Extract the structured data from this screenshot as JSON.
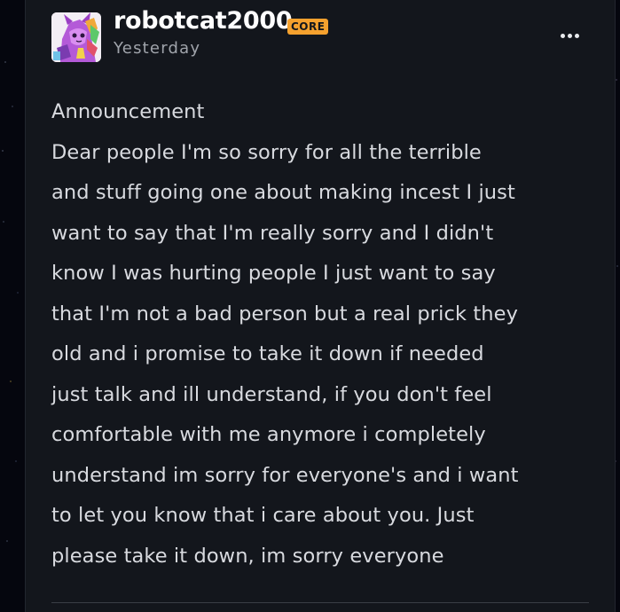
{
  "post": {
    "username": "robotcat2000",
    "badge": "CORE",
    "timestamp": "Yesterday",
    "avatar_icon": "character-art-avatar",
    "more_icon": "more-options-icon",
    "title": "Announcement",
    "body_lines": [
      "Dear people I'm so sorry for all the terrible",
      "and stuff going one about making incest I just",
      "want to say that I'm really sorry and I didn't",
      "know I was hurting people I just want to say",
      "that I'm not a bad person but a real prick they",
      "old and i promise to take it down if needed",
      "just talk and ill understand, if you don't feel",
      "comfortable with me anymore i completely",
      "understand im sorry for everyone's and i want",
      "to let you know that i care about you. Just",
      "please take it down, im sorry everyone"
    ]
  },
  "colors": {
    "card_background": "#13161c",
    "page_background": "#05060e",
    "badge_background": "#f5a12e",
    "username_text": "#ffffff",
    "body_text": "#d8dadf",
    "secondary_text": "#a0a4ab"
  }
}
